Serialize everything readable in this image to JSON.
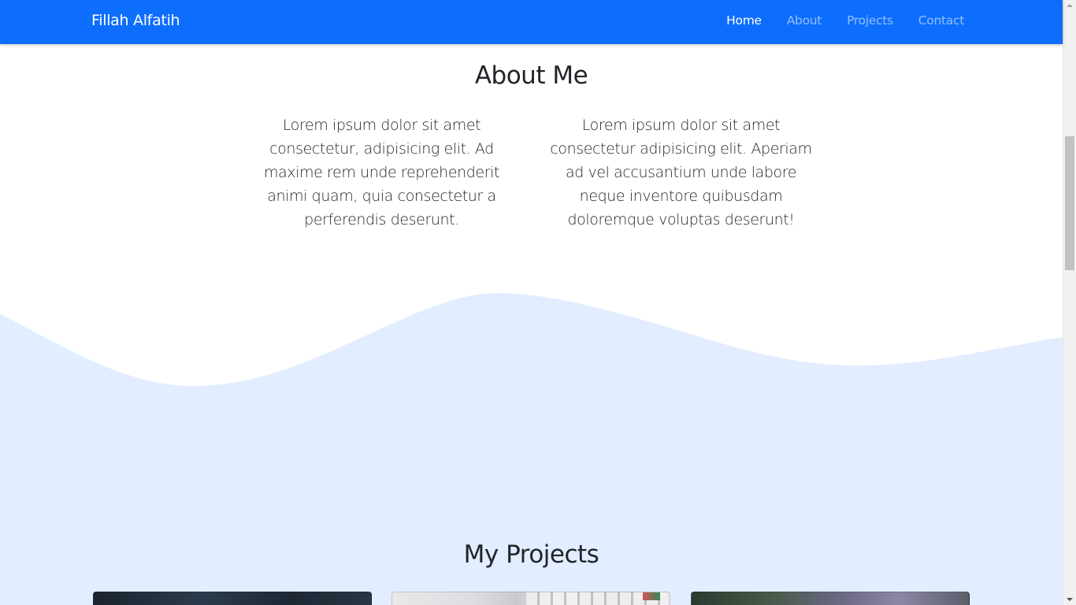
{
  "navbar": {
    "brand": "Fillah Alfatih",
    "links": [
      {
        "label": "Home",
        "active": true
      },
      {
        "label": "About",
        "active": false
      },
      {
        "label": "Projects",
        "active": false
      },
      {
        "label": "Contact",
        "active": false
      }
    ],
    "color": "#0d6efd"
  },
  "about": {
    "title": "About Me",
    "paragraphs": [
      "Lorem ipsum dolor sit amet consectetur, adipisicing elit. Ad maxime rem unde reprehenderit animi quam, quia consectetur a perferendis deserunt.",
      "Lorem ipsum dolor sit amet consectetur adipisicing elit. Aperiam ad vel accusantium unde labore neque inventore quibusdam doloremque voluptas deserunt!"
    ]
  },
  "projects": {
    "title": "My Projects",
    "background_color": "#e2edff",
    "cards": [
      {
        "image": "dark-tech-photo"
      },
      {
        "image": "keyboard-photo"
      },
      {
        "image": "circuit-board-photo"
      }
    ]
  }
}
